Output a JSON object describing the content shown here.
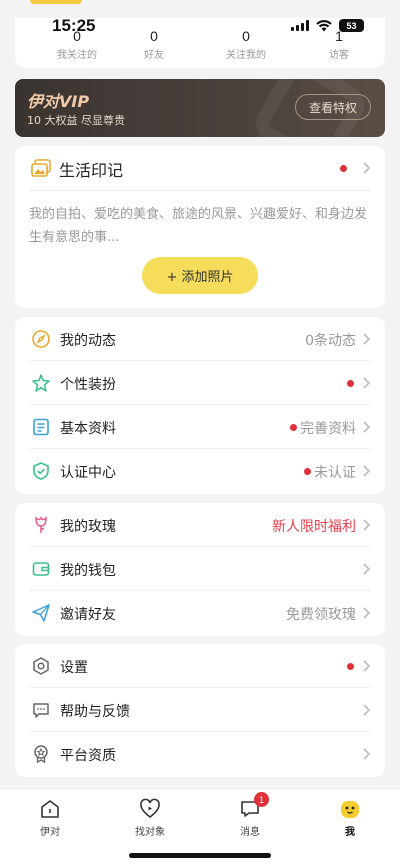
{
  "status_bar": {
    "time": "15:25",
    "battery": "53"
  },
  "stats": [
    {
      "value": "0",
      "label": "我关注的"
    },
    {
      "value": "0",
      "label": "好友"
    },
    {
      "value": "0",
      "label": "关注我的"
    },
    {
      "value": "1",
      "label": "访客"
    }
  ],
  "vip": {
    "title": "伊对VIP",
    "subtitle": "10 大权益 尽显尊贵",
    "button": "查看特权"
  },
  "life": {
    "title": "生活印记",
    "description": "我的自拍、爱吃的美食、旅途的风景、兴趣爱好、和身边发生有意思的事...",
    "add_button": "+ 添加照片"
  },
  "section1": [
    {
      "label": "我的动态",
      "value": "0条动态",
      "icon": "compass-icon"
    },
    {
      "label": "个性装扮",
      "value": "",
      "icon": "star-icon"
    },
    {
      "label": "基本资料",
      "value": "完善资料",
      "icon": "document-icon"
    },
    {
      "label": "认证中心",
      "value": "未认证",
      "icon": "shield-check-icon"
    }
  ],
  "section2": [
    {
      "label": "我的玫瑰",
      "value": "新人限时福利",
      "icon": "rose-icon"
    },
    {
      "label": "我的钱包",
      "value": "",
      "icon": "wallet-icon"
    },
    {
      "label": "邀请好友",
      "value": "免费领玫瑰",
      "icon": "paper-plane-icon"
    }
  ],
  "section3": [
    {
      "label": "设置",
      "value": "",
      "icon": "hexagon-settings-icon"
    },
    {
      "label": "帮助与反馈",
      "value": "",
      "icon": "chat-bubble-icon"
    },
    {
      "label": "平台资质",
      "value": "",
      "icon": "certificate-icon"
    }
  ],
  "tabs": [
    {
      "label": "伊对",
      "icon": "home-icon"
    },
    {
      "label": "找对象",
      "icon": "heart-play-icon"
    },
    {
      "label": "消息",
      "icon": "message-icon",
      "badge": "1"
    },
    {
      "label": "我",
      "icon": "profile-face-icon"
    }
  ],
  "colors": {
    "accent_yellow": "#f6dc5b",
    "alert_red": "#e0303a",
    "vip_gold": "#f0c9a8"
  }
}
